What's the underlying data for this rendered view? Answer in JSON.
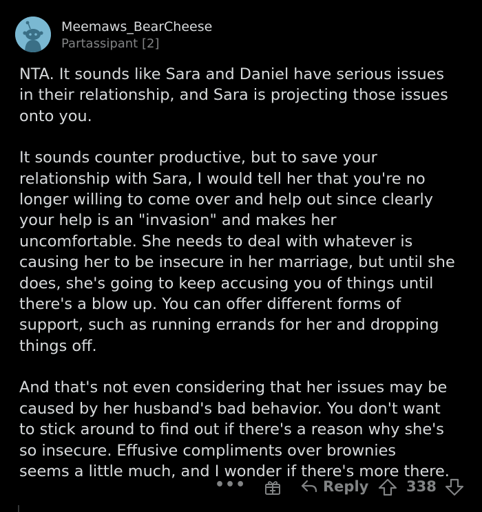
{
  "comment": {
    "author": "Meemaws_BearCheese",
    "flair": "Partassipant [2]",
    "paragraphs": [
      "NTA.  It sounds like Sara and Daniel have serious issues\nin their relationship, and Sara is projecting those issues\nonto you.",
      "It sounds counter productive, but to save your\nrelationship with Sara, I would tell her that you're no\nlonger willing to come over and help out since clearly\nyour help is an \"invasion\" and makes her\nuncomfortable.  She needs to deal with whatever is\ncausing her to be insecure in her marriage, but until she\ndoes, she's going to keep accusing you of things until\nthere's a blow up.  You can offer different forms of\nsupport, such as running errands for her and dropping\nthings off.",
      "And that's not even considering that her issues may be\ncaused by her husband's bad behavior.  You don't want\nto stick around to find out if there's a reason why she's\nso insecure.  Effusive compliments over brownies\nseems a little much, and I wonder if there's more there."
    ]
  },
  "actions": {
    "more_label": "•••",
    "reply_label": "Reply",
    "score": "338"
  },
  "icons": {
    "avatar": "snoo-avatar-icon",
    "more": "more-options-icon",
    "award": "award-gift-icon",
    "reply": "reply-arrow-icon",
    "upvote": "upvote-arrow-icon",
    "downvote": "downvote-arrow-icon"
  },
  "colors": {
    "background": "#000000",
    "text": "#d7dadc",
    "muted": "#818384",
    "avatar_bg": "#7ab8d2"
  }
}
